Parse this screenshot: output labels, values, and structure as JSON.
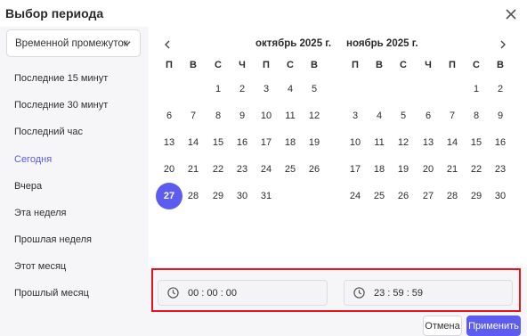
{
  "dialog": {
    "title": "Выбор периода",
    "close_icon": "close-icon"
  },
  "sidebar": {
    "dropdown": {
      "value": "Временной промежуток"
    },
    "presets": [
      {
        "label": "Последние 15 минут",
        "active": false
      },
      {
        "label": "Последние 30 минут",
        "active": false
      },
      {
        "label": "Последний час",
        "active": false
      },
      {
        "label": "Сегодня",
        "active": true
      },
      {
        "label": "Вчера",
        "active": false
      },
      {
        "label": "Эта неделя",
        "active": false
      },
      {
        "label": "Прошлая неделя",
        "active": false
      },
      {
        "label": "Этот месяц",
        "active": false
      },
      {
        "label": "Прошлый месяц",
        "active": false
      }
    ]
  },
  "calendar": {
    "weekdays": [
      "П",
      "В",
      "С",
      "Ч",
      "П",
      "С",
      "В"
    ],
    "months": [
      {
        "title": "октябрь 2025 г.",
        "weeks": [
          [
            "",
            "",
            "1",
            "2",
            "3",
            "4",
            "5"
          ],
          [
            "6",
            "7",
            "8",
            "9",
            "10",
            "11",
            "12"
          ],
          [
            "13",
            "14",
            "15",
            "16",
            "17",
            "18",
            "19"
          ],
          [
            "20",
            "21",
            "22",
            "23",
            "24",
            "25",
            "26"
          ],
          [
            "27",
            "28",
            "29",
            "30",
            "31",
            "",
            ""
          ]
        ],
        "selected": "27"
      },
      {
        "title": "ноябрь 2025 г.",
        "weeks": [
          [
            "",
            "",
            "",
            "",
            "",
            "1",
            "2"
          ],
          [
            "3",
            "4",
            "5",
            "6",
            "7",
            "8",
            "9"
          ],
          [
            "10",
            "11",
            "12",
            "13",
            "14",
            "15",
            "16"
          ],
          [
            "17",
            "18",
            "19",
            "20",
            "21",
            "22",
            "23"
          ],
          [
            "24",
            "25",
            "26",
            "27",
            "28",
            "29",
            "30"
          ]
        ],
        "selected": ""
      }
    ]
  },
  "time": {
    "start": "00 : 00 : 00",
    "end": "23 : 59 : 59"
  },
  "actions": {
    "cancel": "Отмена",
    "apply": "Применить"
  },
  "colors": {
    "accent": "#5c5cf0",
    "highlight": "#e8121b",
    "panel": "#f6f6f8"
  }
}
